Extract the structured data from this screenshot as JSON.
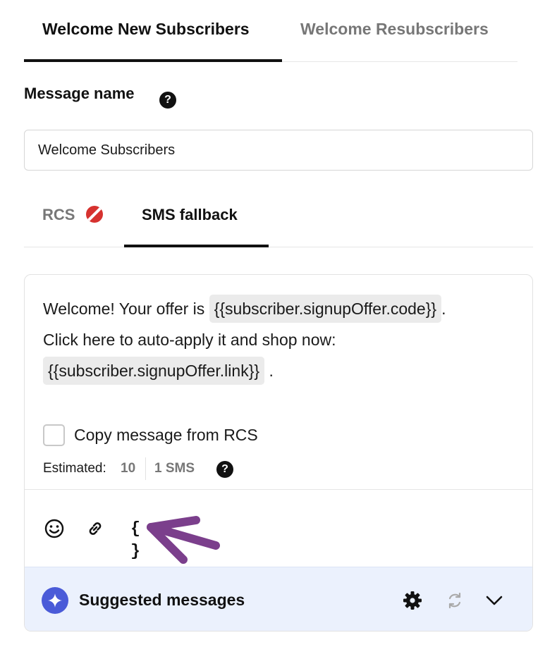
{
  "top_tabs": [
    {
      "label": "Welcome New Subscribers",
      "active": true
    },
    {
      "label": "Welcome Resubscribers",
      "active": false
    }
  ],
  "message_name": {
    "label": "Message name",
    "help_glyph": "?",
    "value": "Welcome Subscribers"
  },
  "channel_tabs": [
    {
      "label": "RCS",
      "status_icon": "disabled-icon",
      "active": false
    },
    {
      "label": "SMS fallback",
      "active": true
    }
  ],
  "editor": {
    "line1_text": "Welcome! Your offer is ",
    "token1": "{{subscriber.signupOffer.code}}",
    "line1_end": ".",
    "line2_text": "Click here to auto-apply it and shop now:",
    "token2": "{{subscriber.signupOffer.link}}",
    "line3_end": " ."
  },
  "copy_option": {
    "label": "Copy message from RCS",
    "checked": false
  },
  "estimate": {
    "label": "Estimated: ",
    "value": "10",
    "sms_count": "1 SMS",
    "help_glyph": "?"
  },
  "toolbar": {
    "icons": [
      "emoji-icon",
      "link-icon",
      "variable-icon"
    ],
    "variable_glyph": "{ }"
  },
  "suggested": {
    "label": "Suggested messages",
    "icons": [
      "sparkle-icon",
      "gear-icon",
      "refresh-icon",
      "chevron-down-icon"
    ]
  },
  "annotation": {
    "arrow_color": "#7b3f8c"
  },
  "colors": {
    "accent_blue": "#4a5bd8",
    "suggest_bg": "#ebf1fd",
    "rcs_badge": "#d6322f",
    "token_bg": "#ebebeb"
  }
}
